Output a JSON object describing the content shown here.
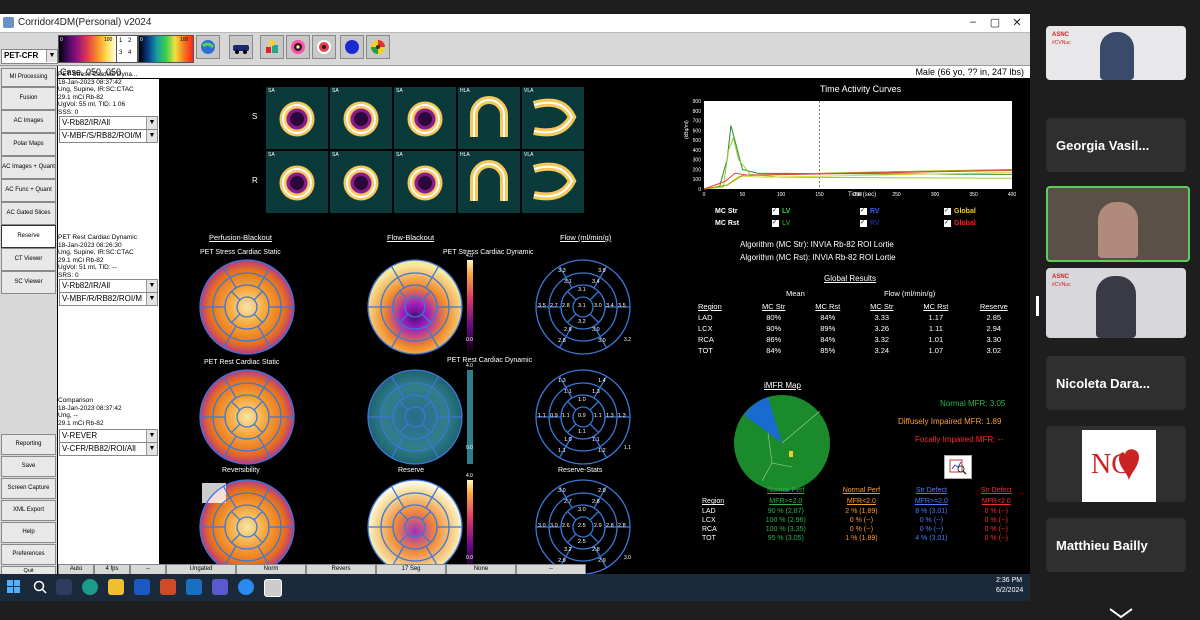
{
  "app": {
    "title": "Corridor4DM(Personal) v2024",
    "mode": "PET-CFR",
    "case": "Case, 050, 050",
    "patient": "Male (66 yo, ?? in, 247 lbs)"
  },
  "toolbar": {
    "lut_ticks": [
      "0",
      "100",
      "0",
      "100"
    ],
    "grid_numbers": [
      "1",
      "2",
      "3",
      "4"
    ]
  },
  "sidebar": [
    "MI Processing",
    "Fusion",
    "AC Images",
    "Polar Maps",
    "AC Images + Quant",
    "AC Func + Quant",
    "AC Gated Slices",
    "Reserve",
    "CT Viewer",
    "SC Viewer",
    "Reporting",
    "Save",
    "Screen Capture",
    "XML Export",
    "Help",
    "Preferences",
    "Quit"
  ],
  "datasets": [
    {
      "title": "PET Stress Cardiac Dyna...",
      "date": "18-Jan-2023 08:37:42",
      "desc": "Ung, Supine, IR:SC:CTAC",
      "dose": "29.1 mCi Rb-82",
      "vol": "UgVol: 55 ml, TID: 1.06",
      "score": "SSS: 0",
      "sel1": "V-Rb82/IR/All",
      "sel2": "V-MBF/S/RB82/ROI/M"
    },
    {
      "title": "PET Rest Cardiac Dynamic",
      "date": "18-Jan-2023 08:26:30",
      "desc": "Ung, Supine, IR:SC:CTAC",
      "dose": "29.1 mCi Rb-82",
      "vol": "UgVol: 51 ml, TID: --",
      "score": "SRS: 0",
      "sel1": "V-Rb82/IR/All",
      "sel2": "V-MBF/R/RB82/ROI/M"
    },
    {
      "title": "Comparison",
      "date": "18-Jan-2023 08:37:42",
      "desc": "Ung, --",
      "dose": "29.1 mCi Rb-82",
      "sel1": "V-REVER",
      "sel2": "V-CFR/RB82/ROI/All"
    }
  ],
  "slices": {
    "labels": [
      "SA",
      "SA",
      "SA",
      "HLA",
      "VLA"
    ],
    "rows": [
      "S",
      "R"
    ]
  },
  "polar": {
    "col_titles": [
      "Perfusion-Blackout",
      "Flow-Blackout",
      "Flow (ml/min/g)"
    ],
    "stress_static": "PET Stress Cardiac Static",
    "stress_dynamic": "PET Stress Cardiac Dynamic",
    "rest_static": "PET Rest Cardiac Static",
    "rest_dynamic": "PET Rest Cardiac Dynamic",
    "reversibility": "Reversibility",
    "reserve": "Reserve",
    "reserve_stats": "Reserve-Stats",
    "scale_top": "4.0",
    "scale_bottom": "0.0",
    "stress_scale_right": "3.2",
    "rest_scale_right": "1.1",
    "reserve_scale_right": "3.0",
    "stress_flow": {
      "outer": [
        "3.9",
        "3.5",
        "3.0",
        "2.8",
        "3.5",
        "3.3"
      ],
      "mid": [
        "3.4",
        "3.4",
        "3.0",
        "2.8",
        "2.7",
        "3.1"
      ],
      "inner": [
        "3.1",
        "3.0",
        "3.2",
        "2.8"
      ],
      "apex": "3.1"
    },
    "rest_flow": {
      "outer": [
        "1.4",
        "1.3",
        "1.2",
        "1.1",
        "1.1",
        "1.3"
      ],
      "mid": [
        "1.3",
        "1.3",
        "1.1",
        "1.0",
        "0.9",
        "1.1"
      ],
      "inner": [
        "1.0",
        "1.1",
        "1.1",
        "1.1"
      ],
      "apex": "0.9"
    },
    "reserve_flow": {
      "outer": [
        "2.9",
        "2.8",
        "2.9",
        "2.9",
        "3.0",
        "3.0"
      ],
      "mid": [
        "2.8",
        "2.8",
        "2.8",
        "3.2",
        "3.0",
        "2.7"
      ],
      "inner": [
        "3.0",
        "2.9",
        "2.5",
        "2.6"
      ],
      "apex": "2.5"
    }
  },
  "tac": {
    "title": "Time Activity Curves",
    "ylabel": "(kBq/ml)",
    "xlabel": "Time (sec)",
    "yticks": [
      "900",
      "800",
      "700",
      "600",
      "500",
      "400",
      "300",
      "200",
      "100",
      "0"
    ],
    "xticks": [
      "0",
      "50",
      "100",
      "150",
      "200",
      "250",
      "300",
      "350",
      "400"
    ],
    "chk_rows": [
      {
        "label": "MC Str",
        "lv": "LV",
        "rv": "RV",
        "g": "Global"
      },
      {
        "label": "MC Rst",
        "lv": "LV",
        "rv": "RV",
        "g": "Global"
      }
    ],
    "algo_str": "Algorithm (MC Str):  INVIA Rb-82 ROI Lortie",
    "algo_rst": "Algorithm (MC Rst):  INVIA Rb-82 ROI Lortie"
  },
  "global": {
    "title": "Global Results",
    "h_mean": "Mean",
    "h_flow": "Flow (ml/min/g)",
    "cols": [
      "Region",
      "MC Str",
      "MC Rst",
      "MC Str",
      "MC Rst",
      "Reserve"
    ],
    "rows": [
      [
        "LAD",
        "80%",
        "84%",
        "3.33",
        "1.17",
        "2.85"
      ],
      [
        "LCX",
        "90%",
        "89%",
        "3.26",
        "1.11",
        "2.94"
      ],
      [
        "RCA",
        "86%",
        "84%",
        "3.32",
        "1.01",
        "3.30"
      ],
      [
        "TOT",
        "84%",
        "85%",
        "3.24",
        "1.07",
        "3.02"
      ]
    ]
  },
  "imfr": {
    "title": "iMFR Map",
    "normal": "Normal MFR: 3.05",
    "diffuse": "Diffusely Impaired MFR: 1.89",
    "focal": "Focally Impaired MFR: --",
    "cols": [
      {
        "h1": "",
        "h2": "Region",
        "c": "#ffffff"
      },
      {
        "h1": "Normal Perf",
        "h2": "MFR>=2.0",
        "c": "#2fb34a"
      },
      {
        "h1": "Normal Perf",
        "h2": "MFR<2.0",
        "c": "#ff9a2a"
      },
      {
        "h1": "Str Defect",
        "h2": "MFR>=2.0",
        "c": "#4a7cff"
      },
      {
        "h1": "Str Defect",
        "h2": "MFR<2.0",
        "c": "#ff2a2a"
      }
    ],
    "rows": [
      [
        "LAD",
        "90 %  (2.87)",
        "2 %  (1.89)",
        "8 %  (3.01)",
        "0 %  (--)"
      ],
      [
        "LCX",
        "100 %  (2.96)",
        "0 %  (--)",
        "0 %  (--)",
        "0 %  (--)"
      ],
      [
        "RCA",
        "100 %  (3.35)",
        "0 %  (--)",
        "0 %  (--)",
        "0 %  (--)"
      ],
      [
        "TOT",
        "95 %  (3.05)",
        "1 %  (1.89)",
        "4 %  (3.01)",
        "0 %  (--)"
      ]
    ]
  },
  "status": [
    "Auto",
    "4 fps",
    "--",
    "Ungated",
    "Norm",
    "Revers",
    "17 Seg",
    "None",
    "--"
  ],
  "clock": {
    "time": "2:36 PM",
    "date": "6/2/2024"
  },
  "participants": {
    "names": [
      "Georgia Vasil...",
      "Nicoleta Dara...",
      "Matthieu Bailly"
    ],
    "logo_text": "ASNC",
    "logo_sub": "#CVNuc"
  }
}
